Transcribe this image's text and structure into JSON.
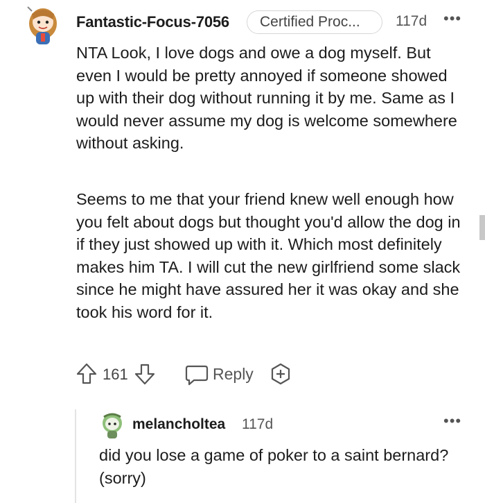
{
  "comment": {
    "username": "Fantastic-Focus-7056",
    "flair": "Certified Proc...",
    "age": "117d",
    "more": "•••",
    "paragraphs": [
      "NTA Look, I love dogs and owe a dog myself. But even I would be pretty annoyed if someone showed up with their dog without running it by me. Same as I would never assume my dog is welcome somewhere without asking.",
      "Seems to me that your friend knew well enough how you felt about dogs but thought you'd allow the dog in if they just showed up with it. Which most definitely makes him TA. I will cut the new girlfriend some slack since he might have assured her it was okay and she took his word for it."
    ],
    "vote_count": "161",
    "reply_label": "Reply",
    "icons": [
      "upvote-icon",
      "downvote-icon",
      "reply-icon",
      "award-icon",
      "more-icon"
    ]
  },
  "reply": {
    "username": "melancholtea",
    "age": "117d",
    "more": "•••",
    "text": "did you lose a game of poker to a saint bernard? (sorry)"
  }
}
